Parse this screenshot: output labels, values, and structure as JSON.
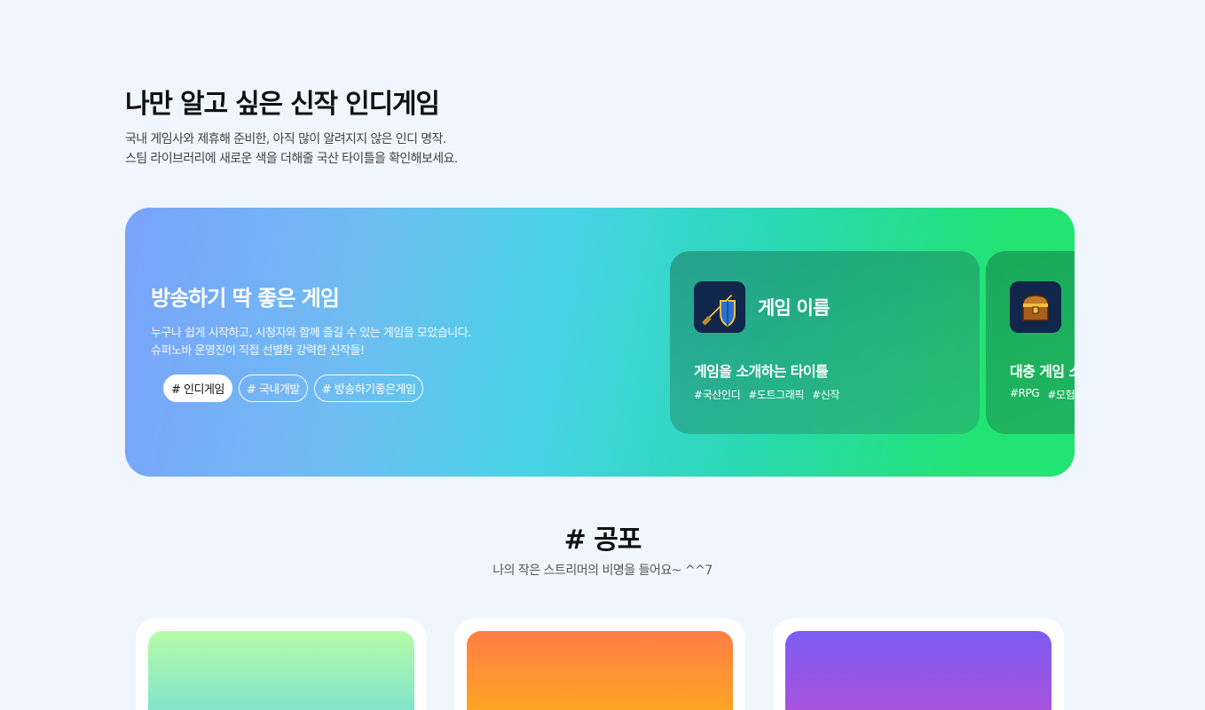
{
  "intro": {
    "title": "나만 알고 싶은 신작 인디게임",
    "desc_line1": "국내 게임사와 제휴해 준비한, 아직 많이 알려지지 않은 인디 명작.",
    "desc_line2": "스팀 라이브러리에 새로운 색을 더해줄 국산 타이틀을 확인해보세요."
  },
  "banner": {
    "title": "방송하기 딱 좋은 게임",
    "desc_line1": "누구나 쉽게 시작하고, 시청자와 함께 즐길 수 있는 게임을 모았습니다.",
    "desc_line2": "슈퍼노바 운영진이 직접 선별한 강력한 신작들!",
    "tags": [
      "# 인디게임",
      "# 국내개발",
      "# 방송하기좋은게임"
    ],
    "active_tag": 0,
    "cards": [
      {
        "icon": "sword-shield-icon",
        "name": "게임 이름",
        "subtitle": "게임을 소개하는 타이틀",
        "tags": [
          "#국산인디",
          "#도트그래픽",
          "#신작"
        ]
      },
      {
        "icon": "treasure-chest-icon",
        "name": "",
        "subtitle": "대충 게임 소",
        "tags": [
          "#RPG",
          "#모험"
        ]
      }
    ]
  },
  "section": {
    "title": "# 공포",
    "subtitle": "나의 작은 스트리머의 비명을 들어요~ ^^7"
  },
  "colors": {
    "background": "#f0f6fd",
    "banner_start": "#7aa2fb",
    "banner_end": "#22e472",
    "thumb1": "#b5fca8",
    "thumb2": "#ff7d44",
    "thumb3": "#7d5cf3"
  }
}
